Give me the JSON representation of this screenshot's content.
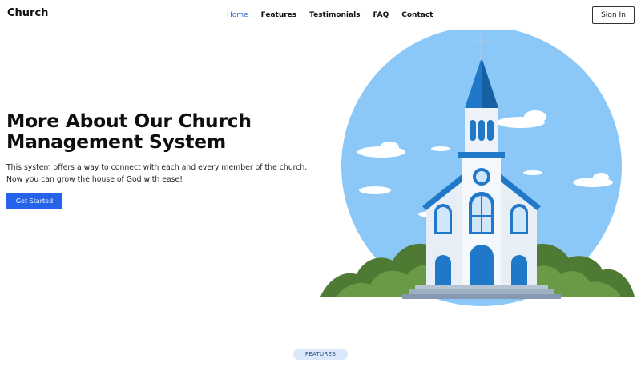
{
  "brand": {
    "name": "Church"
  },
  "nav": {
    "items": [
      {
        "label": "Home",
        "active": true
      },
      {
        "label": "Features",
        "active": false
      },
      {
        "label": "Testimonials",
        "active": false
      },
      {
        "label": "FAQ",
        "active": false
      },
      {
        "label": "Contact",
        "active": false
      }
    ],
    "signin_label": "Sign In"
  },
  "hero": {
    "title": "More About Our Church Management System",
    "description": "This system offers a way to connect with each and every member of the church. Now you can grow the house of God with ease!",
    "cta_label": "Get Started",
    "illustration_icon": "church-illustration"
  },
  "features": {
    "badge": "FEATURES"
  },
  "colors": {
    "accent": "#2563eb",
    "active_nav": "#2c6fde",
    "sky": "#8cc8f7",
    "roof": "#1f78c8",
    "bush": "#5a8a3a"
  }
}
